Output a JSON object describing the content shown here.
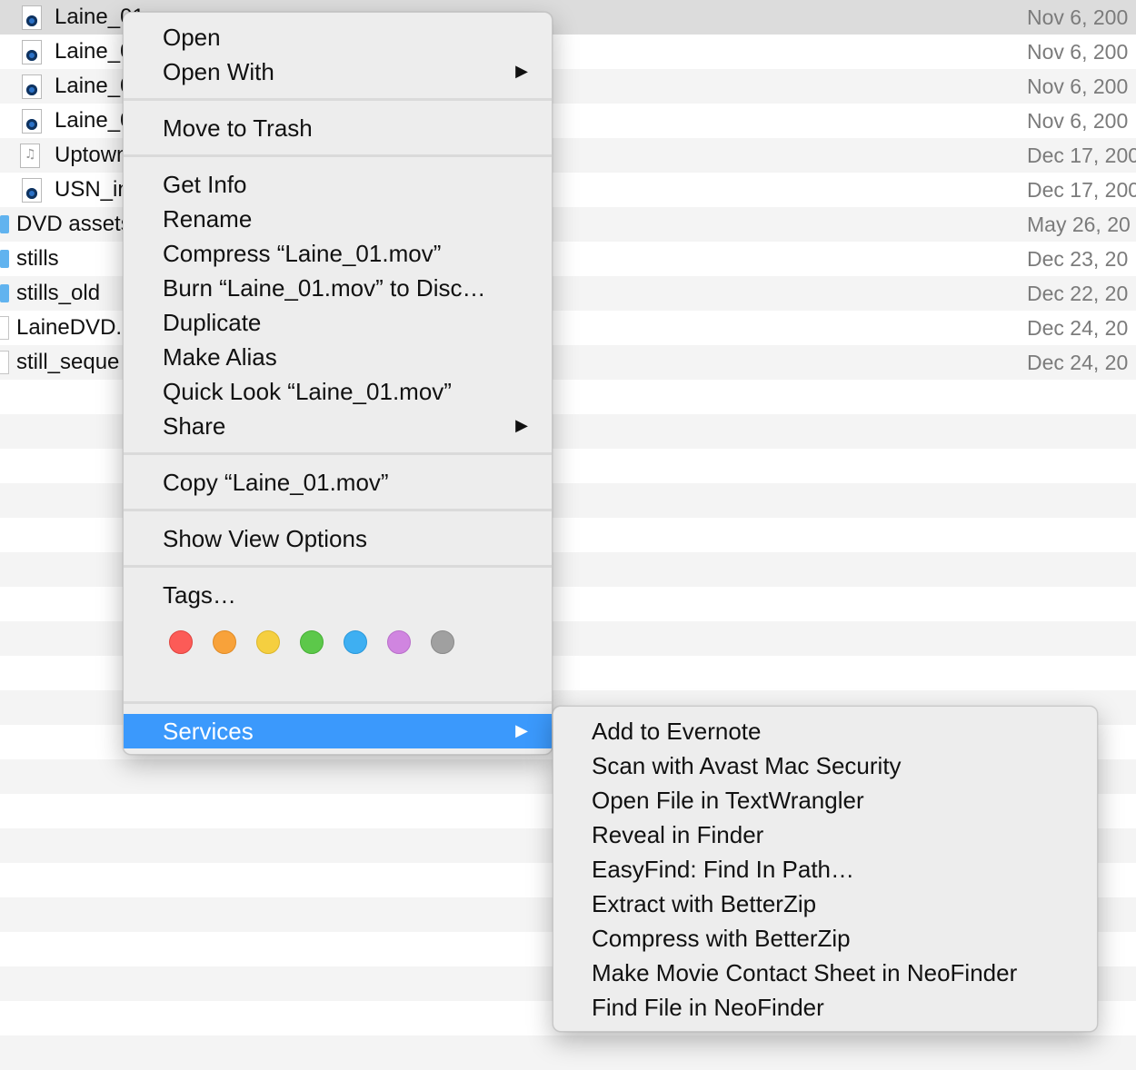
{
  "files": [
    {
      "name": "Laine_01",
      "date": "Nov 6, 200",
      "icon": "movie-file-icon"
    },
    {
      "name": "Laine_0",
      "date": "Nov 6, 200",
      "icon": "movie-file-icon"
    },
    {
      "name": "Laine_0",
      "date": "Nov 6, 200",
      "icon": "movie-file-icon"
    },
    {
      "name": "Laine_0",
      "date": "Nov 6, 200",
      "icon": "movie-file-icon"
    },
    {
      "name": "Uptown",
      "date": "Dec 17, 200",
      "icon": "audio-file-icon"
    },
    {
      "name": "USN_in",
      "date": "Dec 17, 200",
      "icon": "movie-file-icon"
    },
    {
      "name": "DVD assets",
      "date": "May 26, 20",
      "icon": "folder-icon"
    },
    {
      "name": "stills",
      "date": "Dec 23, 20",
      "icon": "folder-icon"
    },
    {
      "name": "stills_old",
      "date": "Dec 22, 20",
      "icon": "folder-icon"
    },
    {
      "name": "LaineDVD.",
      "date": "Dec 24, 20",
      "icon": "document-icon"
    },
    {
      "name": "still_seque",
      "date": "Dec 24, 20",
      "icon": "document-icon"
    }
  ],
  "context_menu": {
    "open": "Open",
    "open_with": "Open With",
    "move_to_trash": "Move to Trash",
    "get_info": "Get Info",
    "rename": "Rename",
    "compress": "Compress “Laine_01.mov”",
    "burn": "Burn “Laine_01.mov” to Disc…",
    "duplicate": "Duplicate",
    "make_alias": "Make Alias",
    "quick_look": "Quick Look “Laine_01.mov”",
    "share": "Share",
    "copy": "Copy “Laine_01.mov”",
    "show_view_options": "Show View Options",
    "tags": "Tags…",
    "services": "Services",
    "submenu_arrow": "▶",
    "tag_colors": [
      {
        "name": "red",
        "color": "#fc5b57",
        "border": "#e0443f"
      },
      {
        "name": "orange",
        "color": "#f8a23a",
        "border": "#e08b26"
      },
      {
        "name": "yellow",
        "color": "#f5cf40",
        "border": "#dcb72b"
      },
      {
        "name": "green",
        "color": "#5cc84a",
        "border": "#46b035"
      },
      {
        "name": "blue",
        "color": "#3eaff2",
        "border": "#2a98da"
      },
      {
        "name": "purple",
        "color": "#d085e0",
        "border": "#b96fca"
      },
      {
        "name": "gray",
        "color": "#a0a0a0",
        "border": "#8a8a8a"
      }
    ]
  },
  "services_menu": {
    "items": [
      "Add to Evernote",
      "Scan with Avast Mac Security",
      "Open File in TextWrangler",
      "Reveal in Finder",
      "EasyFind: Find In Path…",
      "Extract with BetterZip",
      "Compress with BetterZip",
      "Make Movie Contact Sheet in NeoFinder",
      "Find File in NeoFinder"
    ]
  },
  "colors": {
    "highlight": "#3b99fc",
    "menu_bg": "#ededed",
    "row_alt": "#f4f4f4"
  }
}
